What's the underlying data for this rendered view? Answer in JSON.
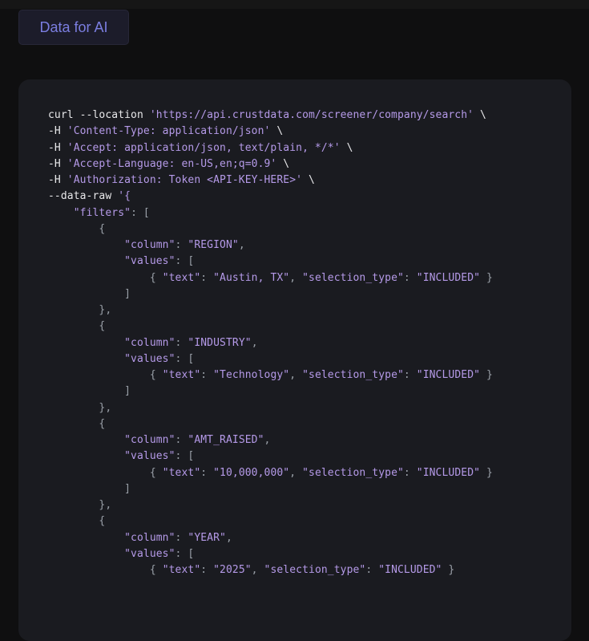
{
  "header": {
    "button_label": "Data for AI"
  },
  "colors": {
    "accent": "#7b7ee0",
    "string": "#b59ae8",
    "text": "#e8e8ea",
    "punct": "#9aa0a8",
    "card_bg": "#1a1b20"
  },
  "code": {
    "lines": [
      [
        [
          "d",
          "curl --location "
        ],
        [
          "s",
          "'https://api.crustdata.com/screener/company/search'"
        ],
        [
          "d",
          " \\"
        ]
      ],
      [
        [
          "d",
          "-H "
        ],
        [
          "s",
          "'Content-Type: application/json'"
        ],
        [
          "d",
          " \\"
        ]
      ],
      [
        [
          "d",
          "-H "
        ],
        [
          "s",
          "'Accept: application/json, text/plain, */*'"
        ],
        [
          "d",
          " \\"
        ]
      ],
      [
        [
          "d",
          "-H "
        ],
        [
          "s",
          "'Accept-Language: en-US,en;q=0.9'"
        ],
        [
          "d",
          " \\"
        ]
      ],
      [
        [
          "d",
          "-H "
        ],
        [
          "s",
          "'Authorization: Token <API-KEY-HERE>'"
        ],
        [
          "d",
          " \\"
        ]
      ],
      [
        [
          "d",
          "--data-raw "
        ],
        [
          "s",
          "'{"
        ]
      ],
      [
        [
          "d",
          "    "
        ],
        [
          "s",
          "\"filters\""
        ],
        [
          "p",
          ": ["
        ]
      ],
      [
        [
          "d",
          "        "
        ],
        [
          "p",
          "{"
        ]
      ],
      [
        [
          "d",
          "            "
        ],
        [
          "s",
          "\"column\""
        ],
        [
          "p",
          ": "
        ],
        [
          "s",
          "\"REGION\""
        ],
        [
          "p",
          ","
        ]
      ],
      [
        [
          "d",
          "            "
        ],
        [
          "s",
          "\"values\""
        ],
        [
          "p",
          ": ["
        ]
      ],
      [
        [
          "d",
          "                "
        ],
        [
          "p",
          "{ "
        ],
        [
          "s",
          "\"text\""
        ],
        [
          "p",
          ": "
        ],
        [
          "s",
          "\"Austin, TX\""
        ],
        [
          "p",
          ", "
        ],
        [
          "s",
          "\"selection_type\""
        ],
        [
          "p",
          ": "
        ],
        [
          "s",
          "\"INCLUDED\""
        ],
        [
          "p",
          " }"
        ]
      ],
      [
        [
          "d",
          "            "
        ],
        [
          "p",
          "]"
        ]
      ],
      [
        [
          "d",
          "        "
        ],
        [
          "p",
          "},"
        ]
      ],
      [
        [
          "d",
          "        "
        ],
        [
          "p",
          "{"
        ]
      ],
      [
        [
          "d",
          "            "
        ],
        [
          "s",
          "\"column\""
        ],
        [
          "p",
          ": "
        ],
        [
          "s",
          "\"INDUSTRY\""
        ],
        [
          "p",
          ","
        ]
      ],
      [
        [
          "d",
          "            "
        ],
        [
          "s",
          "\"values\""
        ],
        [
          "p",
          ": ["
        ]
      ],
      [
        [
          "d",
          "                "
        ],
        [
          "p",
          "{ "
        ],
        [
          "s",
          "\"text\""
        ],
        [
          "p",
          ": "
        ],
        [
          "s",
          "\"Technology\""
        ],
        [
          "p",
          ", "
        ],
        [
          "s",
          "\"selection_type\""
        ],
        [
          "p",
          ": "
        ],
        [
          "s",
          "\"INCLUDED\""
        ],
        [
          "p",
          " }"
        ]
      ],
      [
        [
          "d",
          "            "
        ],
        [
          "p",
          "]"
        ]
      ],
      [
        [
          "d",
          "        "
        ],
        [
          "p",
          "},"
        ]
      ],
      [
        [
          "d",
          "        "
        ],
        [
          "p",
          "{"
        ]
      ],
      [
        [
          "d",
          "            "
        ],
        [
          "s",
          "\"column\""
        ],
        [
          "p",
          ": "
        ],
        [
          "s",
          "\"AMT_RAISED\""
        ],
        [
          "p",
          ","
        ]
      ],
      [
        [
          "d",
          "            "
        ],
        [
          "s",
          "\"values\""
        ],
        [
          "p",
          ": ["
        ]
      ],
      [
        [
          "d",
          "                "
        ],
        [
          "p",
          "{ "
        ],
        [
          "s",
          "\"text\""
        ],
        [
          "p",
          ": "
        ],
        [
          "s",
          "\"10,000,000\""
        ],
        [
          "p",
          ", "
        ],
        [
          "s",
          "\"selection_type\""
        ],
        [
          "p",
          ": "
        ],
        [
          "s",
          "\"INCLUDED\""
        ],
        [
          "p",
          " }"
        ]
      ],
      [
        [
          "d",
          "            "
        ],
        [
          "p",
          "]"
        ]
      ],
      [
        [
          "d",
          "        "
        ],
        [
          "p",
          "},"
        ]
      ],
      [
        [
          "d",
          "        "
        ],
        [
          "p",
          "{"
        ]
      ],
      [
        [
          "d",
          "            "
        ],
        [
          "s",
          "\"column\""
        ],
        [
          "p",
          ": "
        ],
        [
          "s",
          "\"YEAR\""
        ],
        [
          "p",
          ","
        ]
      ],
      [
        [
          "d",
          "            "
        ],
        [
          "s",
          "\"values\""
        ],
        [
          "p",
          ": ["
        ]
      ],
      [
        [
          "d",
          "                "
        ],
        [
          "p",
          "{ "
        ],
        [
          "s",
          "\"text\""
        ],
        [
          "p",
          ": "
        ],
        [
          "s",
          "\"2025\""
        ],
        [
          "p",
          ", "
        ],
        [
          "s",
          "\"selection_type\""
        ],
        [
          "p",
          ": "
        ],
        [
          "s",
          "\"INCLUDED\""
        ],
        [
          "p",
          " }"
        ]
      ]
    ]
  }
}
